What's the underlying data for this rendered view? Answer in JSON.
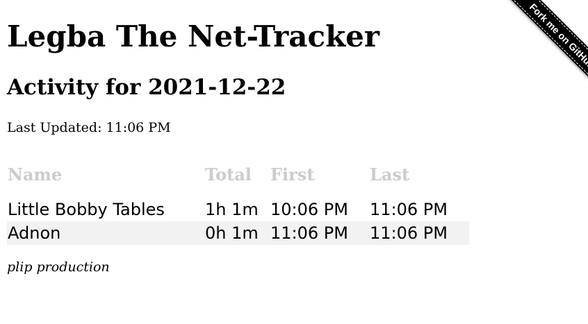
{
  "header": {
    "title": "Legba The Net-Tracker",
    "subtitle": "Activity for 2021-12-22",
    "last_updated": "Last Updated: 11:06 PM"
  },
  "table": {
    "columns": [
      "Name",
      "Total",
      "First",
      "Last"
    ],
    "rows": [
      {
        "name": "Little Bobby Tables",
        "total": "1h 1m",
        "first": "10:06 PM",
        "last": "11:06 PM"
      },
      {
        "name": "Adnon",
        "total": "0h 1m",
        "first": "11:06 PM",
        "last": "11:06 PM"
      }
    ]
  },
  "footer": {
    "text": "plip production"
  },
  "ribbon": {
    "label": "Fork me on GitHub"
  },
  "colors": {
    "header_text": "#cccccc",
    "alt_row": "#f2f2f2",
    "ribbon": "#000000"
  }
}
